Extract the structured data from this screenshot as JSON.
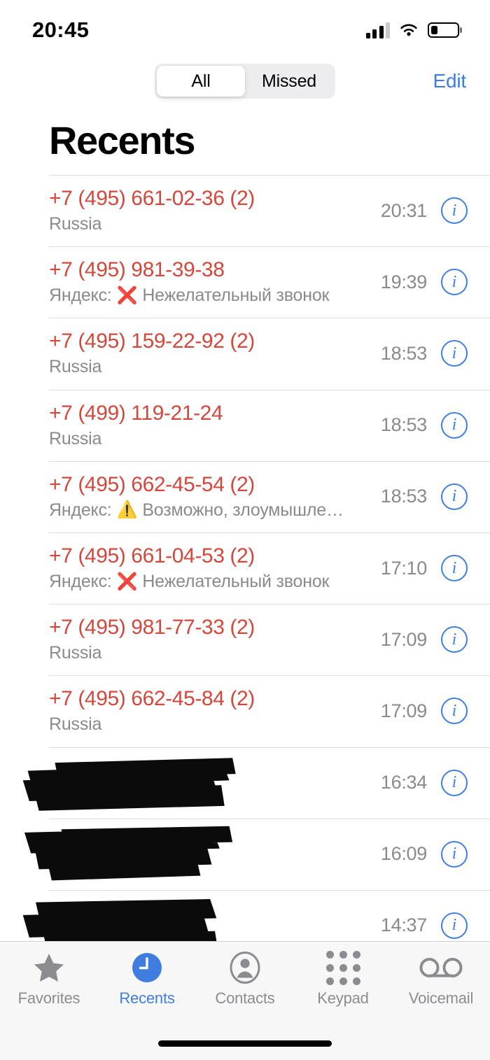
{
  "status_bar": {
    "time": "20:45",
    "signal_icon": "cellular-signal-icon",
    "signal_bars_filled": 3,
    "signal_bars_total": 4,
    "wifi_icon": "wifi-icon",
    "battery_icon": "battery-icon",
    "battery_level_percent": 25
  },
  "navbar": {
    "segments": [
      {
        "label": "All",
        "selected": true
      },
      {
        "label": "Missed",
        "selected": false
      }
    ],
    "edit_label": "Edit"
  },
  "header": {
    "title": "Recents"
  },
  "colors": {
    "call_red": "#d2483c",
    "accent_blue": "#3f7ee0",
    "secondary_gray": "#8a8a8e",
    "separator": "#dededf",
    "segment_track": "#ededef",
    "tabbar_bg": "#f7f7f8"
  },
  "calls": [
    {
      "number": "+7 (495) 661-02-36 (2)",
      "subtitle": "Russia",
      "mark": "",
      "mark_type": "none",
      "time": "20:31",
      "redacted": false
    },
    {
      "number": "+7 (495) 981-39-38",
      "subtitle_prefix": "Яндекс:",
      "subtitle": "Нежелательный звонок",
      "mark": "❌",
      "mark_type": "cross",
      "time": "19:39",
      "redacted": false
    },
    {
      "number": "+7 (495) 159-22-92 (2)",
      "subtitle": "Russia",
      "mark": "",
      "mark_type": "none",
      "time": "18:53",
      "redacted": false
    },
    {
      "number": "+7 (499) 119-21-24",
      "subtitle": "Russia",
      "mark": "",
      "mark_type": "none",
      "time": "18:53",
      "redacted": false
    },
    {
      "number": "+7 (495) 662-45-54 (2)",
      "subtitle_prefix": "Яндекс:",
      "subtitle": "Возможно, злоумышле…",
      "mark": "⚠️",
      "mark_type": "warning",
      "time": "18:53",
      "redacted": false
    },
    {
      "number": "+7 (495) 661-04-53 (2)",
      "subtitle_prefix": "Яндекс:",
      "subtitle": "Нежелательный звонок",
      "mark": "❌",
      "mark_type": "cross",
      "time": "17:10",
      "redacted": false
    },
    {
      "number": "+7 (495) 981-77-33 (2)",
      "subtitle": "Russia",
      "mark": "",
      "mark_type": "none",
      "time": "17:09",
      "redacted": false
    },
    {
      "number": "+7 (495) 662-45-84 (2)",
      "subtitle": "Russia",
      "mark": "",
      "mark_type": "none",
      "time": "17:09",
      "redacted": false
    },
    {
      "number": "",
      "subtitle": "",
      "mark": "",
      "mark_type": "none",
      "time": "16:34",
      "redacted": true
    },
    {
      "number": "",
      "subtitle": "",
      "mark": "",
      "mark_type": "none",
      "time": "16:09",
      "redacted": true
    },
    {
      "number": "",
      "subtitle": "",
      "mark": "",
      "mark_type": "none",
      "time": "14:37",
      "redacted": true
    }
  ],
  "info_button_label": "i",
  "tabbar": {
    "items": [
      {
        "label": "Favorites",
        "icon": "star-icon",
        "active": false
      },
      {
        "label": "Recents",
        "icon": "clock-icon",
        "active": true
      },
      {
        "label": "Contacts",
        "icon": "person-circle-icon",
        "active": false
      },
      {
        "label": "Keypad",
        "icon": "keypad-dots-icon",
        "active": false
      },
      {
        "label": "Voicemail",
        "icon": "voicemail-icon",
        "active": false
      }
    ]
  }
}
